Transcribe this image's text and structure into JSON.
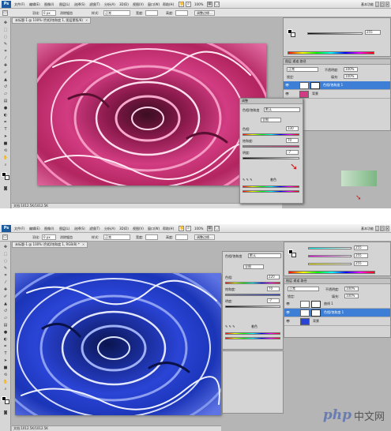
{
  "top": {
    "menubar": {
      "items": [
        "文件(F)",
        "编辑(E)",
        "图像(I)",
        "图层(L)",
        "选择(S)",
        "滤镜(T)",
        "分析(A)",
        "3D(D)",
        "视图(V)",
        "窗口(W)",
        "帮助(H)"
      ],
      "zoom": "100%",
      "workspace": "基本功能"
    },
    "options": {
      "feather_label": "羽化:",
      "feather_value": "0 px",
      "antialias": "消除锯齿",
      "style_label": "样式:",
      "style_value": "正常",
      "width_label": "宽度:",
      "height_label": "高度:",
      "refine": "调整边缘..."
    },
    "doc_tab": {
      "title": "未标题-1 @ 100% (色相/饱和度 1, 图层蒙版/8)",
      "close": "×"
    },
    "status": "文档:1012.5K/1012.5K",
    "adjust_panel": {
      "title": "调整",
      "preset_label": "色相/饱和度",
      "preset_value": "默认",
      "channel": "全图",
      "hue_label": "色相:",
      "hue_value": "330",
      "sat_label": "饱和度:",
      "sat_value": "70",
      "light_label": "明度:",
      "light_value": "-7",
      "colorize_label": "着色"
    },
    "color_panel": {
      "value": "255"
    },
    "layers_panel": {
      "blend": "正常",
      "opacity_label": "不透明度:",
      "opacity": "100%",
      "lock_label": "锁定:",
      "fill_label": "填充:",
      "fill": "100%",
      "layers": [
        {
          "name": "色相/饱和度 1",
          "selected": true
        },
        {
          "name": "背景",
          "selected": false
        }
      ]
    }
  },
  "bottom": {
    "menubar": {
      "items": [
        "文件(F)",
        "编辑(E)",
        "图像(I)",
        "图层(L)",
        "选择(S)",
        "滤镜(T)",
        "分析(A)",
        "3D(D)",
        "视图(V)",
        "窗口(W)",
        "帮助(H)"
      ],
      "zoom": "100%",
      "workspace": "基本功能"
    },
    "options": {
      "feather_label": "羽化:",
      "feather_value": "0 px",
      "antialias": "消除锯齿",
      "style_label": "样式:",
      "style_value": "正常",
      "width_label": "宽度:",
      "height_label": "高度:",
      "refine": "调整边缘..."
    },
    "doc_tab": {
      "title": "未标题-1 @ 100% (色相/饱和度 1, RGB/8) *",
      "close": "×"
    },
    "status": "文档:1012.5K/1012.5K",
    "adjust_panel": {
      "preset_label": "色相/饱和度",
      "preset_value": "默认",
      "channel": "全图",
      "hue_label": "色相:",
      "hue_value": "220",
      "sat_label": "饱和度:",
      "sat_value": "70",
      "light_label": "明度:",
      "light_value": "-7",
      "colorize_label": "着色"
    },
    "color_panel": {
      "r": "255",
      "g": "255",
      "b": "255"
    },
    "layers_panel": {
      "blend": "正常",
      "opacity_label": "不透明度:",
      "opacity": "100%",
      "lock_label": "锁定:",
      "fill_label": "填充:",
      "fill": "100%",
      "layers": [
        {
          "name": "曲线 1",
          "selected": false
        },
        {
          "name": "色相/饱和度 1",
          "selected": true
        },
        {
          "name": "背景",
          "selected": false
        }
      ]
    }
  },
  "watermark": {
    "brand": "php",
    "suffix": "中文网"
  },
  "colors": {
    "pink": "#d23c82",
    "blue": "#2a44d6",
    "selection": "#3d7fd6"
  }
}
